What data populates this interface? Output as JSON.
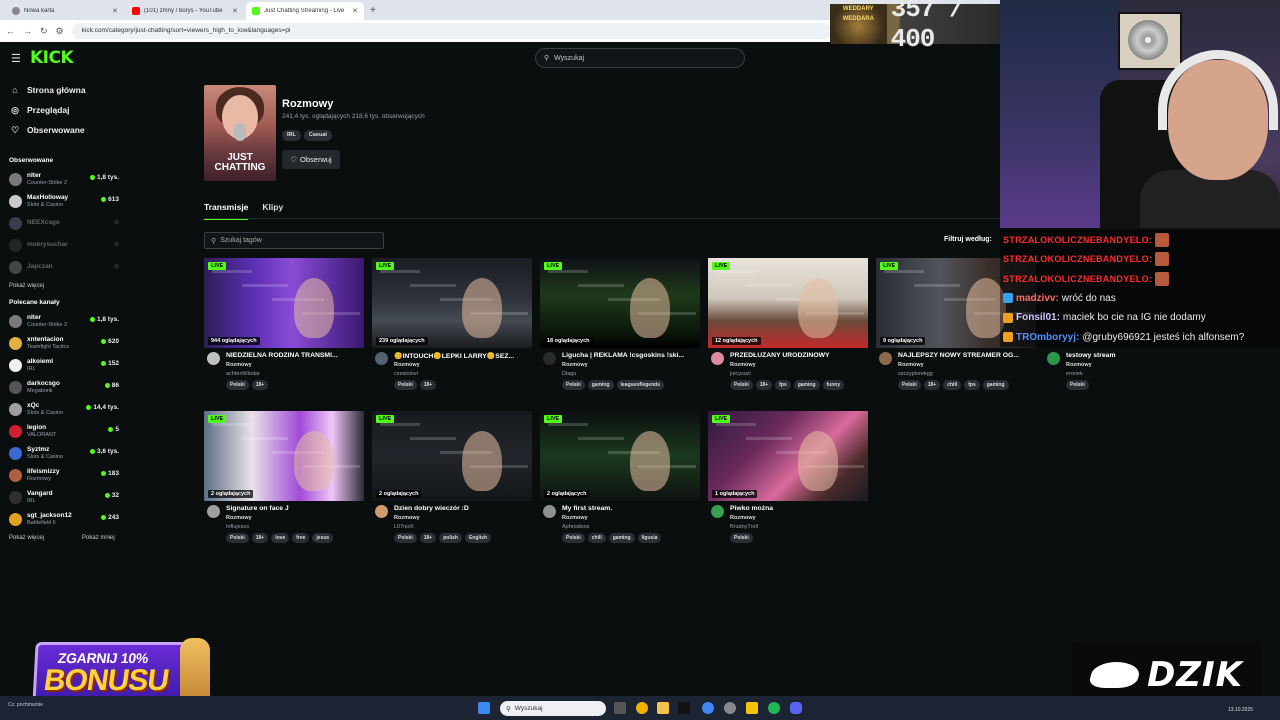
{
  "browser": {
    "tabs": [
      {
        "label": "Nowa karta",
        "color": "#888888"
      },
      {
        "label": "(101) zmny / borys - YouTube",
        "color": "#ff0000"
      },
      {
        "label": "Just Chatting Streaming - Live",
        "color": "#53fc18"
      }
    ],
    "url": "kick.com/category/just-chatting/sort=viewers_high_to_low&languages=pl"
  },
  "overlay": {
    "counter_boss": "WEDDARY WEDDARA",
    "counter": "357 / 400",
    "promo_line1": "ZGARNIJ 10%",
    "promo_line2": "BONUSU",
    "brand": "DZIK"
  },
  "kick": {
    "logo": "KICK",
    "search_placeholder": "Wyszukaj",
    "nav": [
      {
        "label": "Strona główna",
        "icon": "home-icon"
      },
      {
        "label": "Przeglądaj",
        "icon": "browse-icon"
      },
      {
        "label": "Obserwowane",
        "icon": "heart-icon"
      }
    ],
    "followed_title": "Obserwowane",
    "followed": [
      {
        "name": "nIter",
        "category": "Counter-Strike 2",
        "viewers": "1,8 tys.",
        "online": true,
        "color": "#7a7a7a"
      },
      {
        "name": "MaxHolloway",
        "category": "Slots & Casino",
        "viewers": "613",
        "online": true,
        "color": "#c9c9c9"
      },
      {
        "name": "NEEXcsgo",
        "category": "",
        "viewers": "",
        "online": false,
        "color": "#6b7b8a"
      },
      {
        "name": "mokrysuchar",
        "category": "",
        "viewers": "",
        "online": false,
        "color": "#444444"
      },
      {
        "name": "Japczan",
        "category": "",
        "viewers": "",
        "online": false,
        "color": "#8a8a8a"
      }
    ],
    "show_more": "Pokaż więcej",
    "recommended_title": "Polecane kanały",
    "recommended": [
      {
        "name": "nIter",
        "category": "Counter-Strike 2",
        "viewers": "1,8 tys.",
        "color": "#7a7a7a"
      },
      {
        "name": "xntentacion",
        "category": "Teamfight Tactics",
        "viewers": "620",
        "color": "#e0b040"
      },
      {
        "name": "alkoieml",
        "category": "IRL",
        "viewers": "152",
        "color": "#f0f0f0"
      },
      {
        "name": "darkocsgo",
        "category": "Megabonk",
        "viewers": "86",
        "color": "#555555"
      },
      {
        "name": "xQc",
        "category": "Slots & Casino",
        "viewers": "14,4 tys.",
        "color": "#a0a0a0"
      },
      {
        "name": "legion",
        "category": "VALORANT",
        "viewers": "5",
        "color": "#d02030"
      },
      {
        "name": "Syztmz",
        "category": "Slots & Casino",
        "viewers": "3,6 tys.",
        "color": "#3a6ad0"
      },
      {
        "name": "lifeismizzy",
        "category": "Rozmowy",
        "viewers": "183",
        "color": "#b06040"
      },
      {
        "name": "Vangard",
        "category": "IRL",
        "viewers": "32",
        "color": "#303030"
      },
      {
        "name": "sgt_jackson12",
        "category": "Battlefield 6",
        "viewers": "243",
        "color": "#e0a020"
      }
    ],
    "show_more2": "Pokaż więcej",
    "show_less": "Pokaż mniej",
    "category": {
      "cover_text": "JUST CHATTING",
      "title": "Rozmowy",
      "stats": "241,4 tys. oglądających   218,6 tys. obserwujących",
      "tags": [
        "IRL",
        "Casual"
      ],
      "follow": "Obserwuj"
    },
    "tabs": [
      "Transmisje",
      "Klipy"
    ],
    "tag_search_placeholder": "Szukaj tagów",
    "filter_label": "Filtruj według:",
    "live_label": "LIVE",
    "streams": [
      {
        "viewers": "944 oglądających",
        "title": "NIEDZIELNA RODZINA TRANSMI...",
        "category": "Rozmowy",
        "user": "achtenWlodar",
        "tags": [
          "Polski",
          "18+"
        ],
        "avatar": "#c0c0c0",
        "thumb": "th1"
      },
      {
        "viewers": "239 oglądających",
        "title": "😊INTOUCH😊LEPKI LARRY😊SEZ...",
        "category": "Rozmowy",
        "user": "czesioinvi",
        "tags": [
          "Polski",
          "18+"
        ],
        "avatar": "#556070",
        "thumb": "th2"
      },
      {
        "viewers": "18 oglądających",
        "title": "Ligucha | REKLAMA !csgoskins !ski...",
        "category": "Rozmowy",
        "user": "Dlagu",
        "tags": [
          "Polski",
          "gaming",
          "leagueoflegends"
        ],
        "avatar": "#2a2a2a",
        "thumb": "th3"
      },
      {
        "viewers": "12 oglądających",
        "title": "PRZEDŁUŻANY URODZINOWY",
        "category": "Rozmowy",
        "user": "juicysuzi",
        "tags": [
          "Polski",
          "18+",
          "fps",
          "gaming",
          "funny"
        ],
        "avatar": "#e08aa0",
        "thumb": "th4"
      },
      {
        "viewers": "9 oglądających",
        "title": "NAJLEPSZY NOWY STREAMER OG...",
        "category": "Rozmowy",
        "user": "szczypiorekgg",
        "tags": [
          "Polski",
          "18+",
          "chill",
          "fps",
          "gaming"
        ],
        "avatar": "#8a6a4a",
        "thumb": "th5"
      },
      {
        "viewers": "",
        "title": "testowy stream",
        "category": "Rozmowy",
        "user": "eronek",
        "tags": [
          "Polski"
        ],
        "avatar": "#2a9a4a",
        "thumb": "th5"
      },
      {
        "viewers": "2 oglądających",
        "title": "Signature on face J",
        "category": "Rozmowy",
        "user": "Influjesus",
        "tags": [
          "Polski",
          "18+",
          "love",
          "free",
          "jesus"
        ],
        "avatar": "#a0a0a0",
        "thumb": "th6"
      },
      {
        "viewers": "2 oglądających",
        "title": "Dzien dobry wieczór :D",
        "category": "Rozmowy",
        "user": "L07nicK",
        "tags": [
          "Polski",
          "18+",
          "polish",
          "English"
        ],
        "avatar": "#d09a6a",
        "thumb": "th7"
      },
      {
        "viewers": "2 oglądających",
        "title": "My first stream.",
        "category": "Rozmowy",
        "user": "Aphrodixos",
        "tags": [
          "Polski",
          "chill",
          "gaming",
          "ligusia"
        ],
        "avatar": "#909090",
        "thumb": "th8"
      },
      {
        "viewers": "1 oglądających",
        "title": "Piwko można",
        "category": "Rozmowy",
        "user": "BrudnyTroll",
        "tags": [
          "Polski"
        ],
        "avatar": "#3aa050",
        "thumb": "th9"
      }
    ]
  },
  "chat": [
    {
      "user": "STRZALOKOLICZNEBANDYELO:",
      "text": "",
      "style": "u1",
      "emote": true
    },
    {
      "user": "STRZALOKOLICZNEBANDYELO:",
      "text": "",
      "style": "u1",
      "emote": true
    },
    {
      "user": "STRZALOKOLICZNEBANDYELO:",
      "text": "",
      "style": "u1",
      "emote": true
    },
    {
      "user": "madzivv:",
      "text": "wróć do nas",
      "style": "u2",
      "emote": false
    },
    {
      "user": "Fonsil01:",
      "text": "maciek bo cie na IG nie dodamy",
      "style": "u3",
      "emote": false
    },
    {
      "user": "TROmboryyj:",
      "text": "@gruby696921 jesteś ich alfonsem?",
      "style": "u4",
      "emote": false
    }
  ],
  "taskbar": {
    "search": "Wyszukaj",
    "weather": "Cz. pochmurnie",
    "date": "13.10.2025"
  }
}
